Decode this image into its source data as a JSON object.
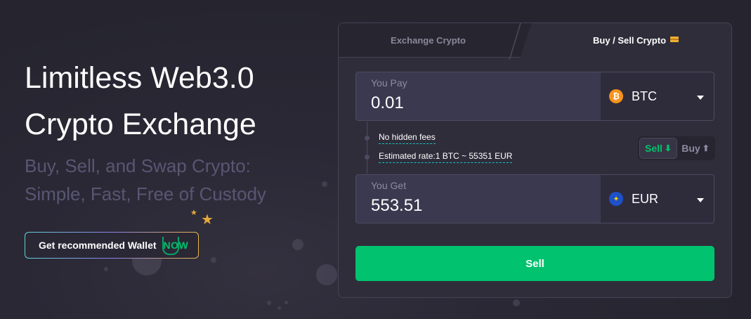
{
  "hero": {
    "title_line1": "Limitless Web3.0",
    "title_line2": "Crypto Exchange",
    "subtitle_line1": "Buy, Sell, and Swap Crypto:",
    "subtitle_line2": "Simple, Fast, Free of Custody",
    "wallet_button": "Get recommended Wallet",
    "wallet_logo_text": "NOW"
  },
  "tabs": {
    "exchange": "Exchange Crypto",
    "buy_sell": "Buy / Sell Crypto",
    "active": "buy_sell",
    "buy_sell_icon": "credit-card-icon"
  },
  "you_pay": {
    "label": "You Pay",
    "value": "0.01",
    "currency_code": "BTC",
    "currency_symbol": "₿",
    "currency_icon": "bitcoin-icon",
    "currency_color": "#f7931a"
  },
  "info": {
    "no_fees": "No hidden fees",
    "rate": "Estimated rate:1 BTC ~ 55351 EUR"
  },
  "direction_toggle": {
    "sell": "Sell",
    "sell_arrow": "⬇",
    "buy": "Buy",
    "buy_arrow": "⬆",
    "selected": "sell"
  },
  "you_get": {
    "label": "You Get",
    "value": "553.51",
    "currency_code": "EUR",
    "currency_symbol": "✦",
    "currency_icon": "euro-flag-icon",
    "currency_color": "#1e50c8"
  },
  "action_button": "Sell",
  "colors": {
    "accent": "#00c26f",
    "background": "#2a2835",
    "panel": "#2f2d3a",
    "subtitle": "#595673"
  }
}
